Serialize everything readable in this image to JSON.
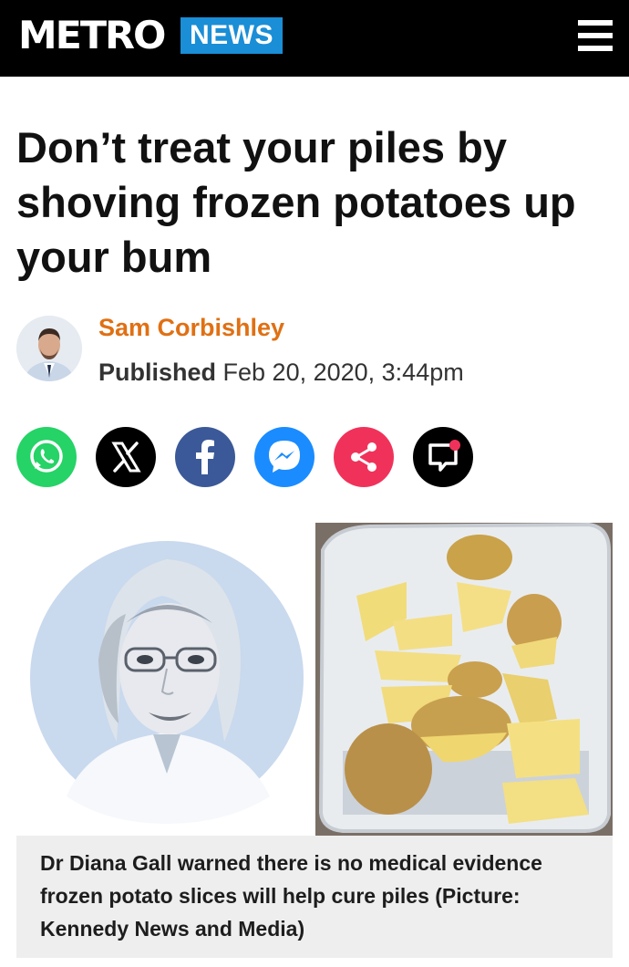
{
  "header": {
    "logo": "METRO",
    "section": "NEWS",
    "menu_icon": "hamburger-menu-icon",
    "background": "#000000",
    "section_color": "#1a8ed6"
  },
  "article": {
    "headline": "Don’t treat your piles by shoving frozen potatoes up your bum",
    "author": "Sam Corbishley",
    "author_color": "#e07013",
    "published_label": "Published",
    "published_date": "Feb 20, 2020, 3:44pm"
  },
  "share_buttons": [
    {
      "icon": "whatsapp-icon",
      "color": "#25d366"
    },
    {
      "icon": "x-icon",
      "color": "#000000"
    },
    {
      "icon": "facebook-icon",
      "color": "#3b5998"
    },
    {
      "icon": "messenger-icon",
      "color": "#1a8cff"
    },
    {
      "icon": "share-icon",
      "color": "#f0325a"
    },
    {
      "icon": "comment-icon",
      "color": "#000000"
    }
  ],
  "images": {
    "left": "doctor-portrait",
    "right": "potato-slices-in-tray"
  },
  "caption": "Dr Diana Gall warned there is no medical evidence frozen potato slices will help cure piles (Picture: Kennedy News and Media)"
}
